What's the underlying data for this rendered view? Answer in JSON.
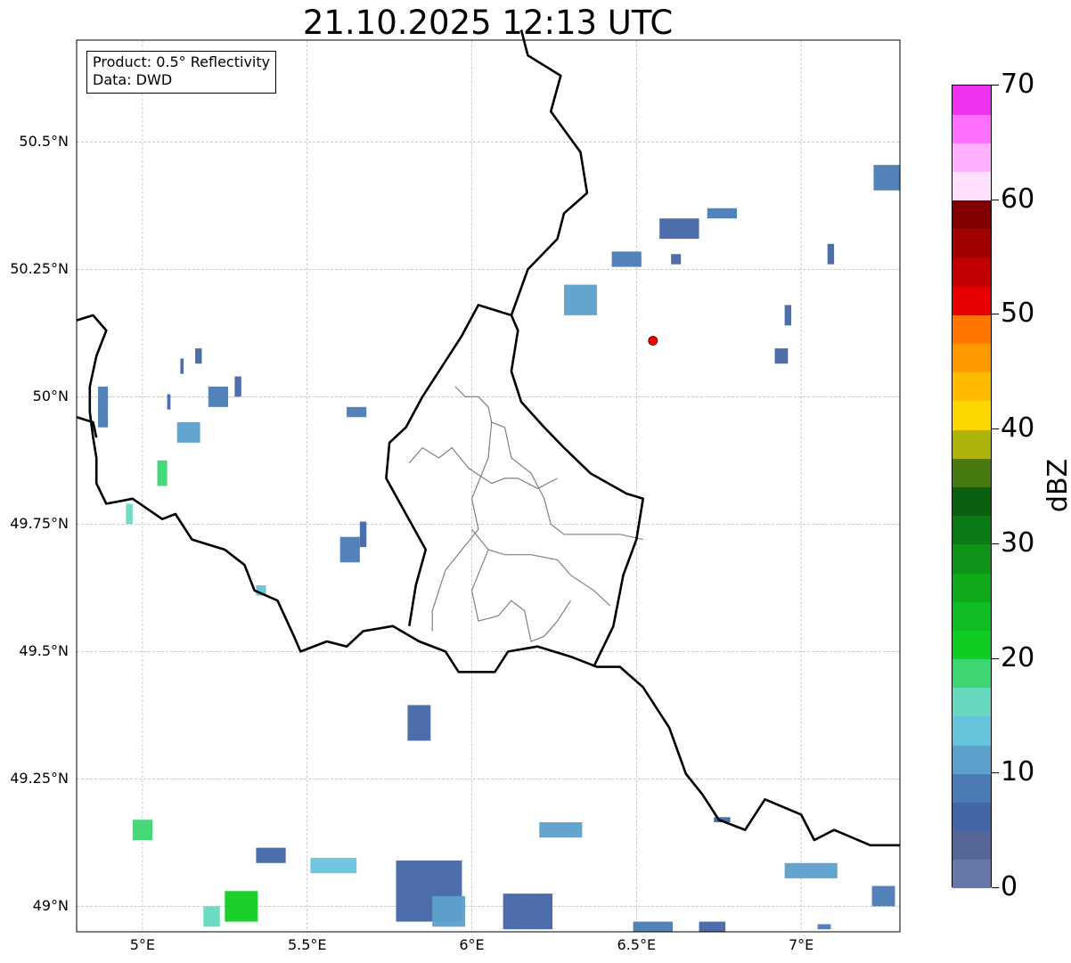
{
  "title": "21.10.2025 12:13 UTC",
  "info_box": {
    "product": "Product: 0.5° Reflectivity",
    "data": "Data: DWD"
  },
  "map_extent": {
    "lon_min": 4.8,
    "lon_max": 7.3,
    "lat_min": 48.95,
    "lat_max": 50.7
  },
  "lat_ticks": [
    {
      "value": 50.5,
      "label": "50.5°N"
    },
    {
      "value": 50.25,
      "label": "50.25°N"
    },
    {
      "value": 50.0,
      "label": "50°N"
    },
    {
      "value": 49.75,
      "label": "49.75°N"
    },
    {
      "value": 49.5,
      "label": "49.5°N"
    },
    {
      "value": 49.25,
      "label": "49.25°N"
    },
    {
      "value": 49.0,
      "label": "49°N"
    }
  ],
  "lon_ticks": [
    {
      "value": 5.0,
      "label": "5°E"
    },
    {
      "value": 5.5,
      "label": "5.5°E"
    },
    {
      "value": 6.0,
      "label": "6°E"
    },
    {
      "value": 6.5,
      "label": "6.5°E"
    },
    {
      "value": 7.0,
      "label": "7°E"
    }
  ],
  "radar_site": {
    "lon": 6.55,
    "lat": 50.11,
    "color": "#ff0000"
  },
  "colorbar": {
    "label": "dBZ",
    "min": 0,
    "max": 70,
    "step": 2.5,
    "tick_labels": [
      {
        "value": 0,
        "label": "0"
      },
      {
        "value": 10,
        "label": "10"
      },
      {
        "value": 20,
        "label": "20"
      },
      {
        "value": 30,
        "label": "30"
      },
      {
        "value": 40,
        "label": "40"
      },
      {
        "value": 50,
        "label": "50"
      },
      {
        "value": 60,
        "label": "60"
      },
      {
        "value": 70,
        "label": "70"
      }
    ],
    "colors": [
      "#6677aa",
      "#556699",
      "#4466a6",
      "#4a7bb5",
      "#5ca0cc",
      "#66c4dd",
      "#66d9bf",
      "#3dd672",
      "#11cc22",
      "#11bb22",
      "#11a81a",
      "#0f9218",
      "#0a7a14",
      "#0a5f10",
      "#477a10",
      "#adb30a",
      "#ffd700",
      "#ffbb00",
      "#ff9900",
      "#ff7700",
      "#e60000",
      "#c00000",
      "#a00000",
      "#800000",
      "#ffe0ff",
      "#ffb0ff",
      "#ff70ff",
      "#ee33ee"
    ]
  },
  "echoes": [
    {
      "lon": 4.88,
      "lat": 49.98,
      "w": 0.03,
      "h": 0.08,
      "c": "#4a7bb5"
    },
    {
      "lon": 5.08,
      "lat": 49.99,
      "w": 0.01,
      "h": 0.03,
      "c": "#4466a6"
    },
    {
      "lon": 5.12,
      "lat": 50.06,
      "w": 0.01,
      "h": 0.03,
      "c": "#4466a6"
    },
    {
      "lon": 5.17,
      "lat": 50.08,
      "w": 0.02,
      "h": 0.03,
      "c": "#4466a6"
    },
    {
      "lon": 5.23,
      "lat": 50.0,
      "w": 0.06,
      "h": 0.04,
      "c": "#4a7bb5"
    },
    {
      "lon": 5.29,
      "lat": 50.02,
      "w": 0.02,
      "h": 0.04,
      "c": "#4466a6"
    },
    {
      "lon": 5.14,
      "lat": 49.93,
      "w": 0.07,
      "h": 0.04,
      "c": "#5ca0cc"
    },
    {
      "lon": 5.06,
      "lat": 49.85,
      "w": 0.03,
      "h": 0.05,
      "c": "#3dd672"
    },
    {
      "lon": 4.96,
      "lat": 49.77,
      "w": 0.02,
      "h": 0.04,
      "c": "#66d9bf"
    },
    {
      "lon": 5.65,
      "lat": 49.97,
      "w": 0.06,
      "h": 0.02,
      "c": "#4a7bb5"
    },
    {
      "lon": 5.63,
      "lat": 49.7,
      "w": 0.06,
      "h": 0.05,
      "c": "#4a7bb5"
    },
    {
      "lon": 5.67,
      "lat": 49.73,
      "w": 0.02,
      "h": 0.05,
      "c": "#4466a6"
    },
    {
      "lon": 5.36,
      "lat": 49.62,
      "w": 0.03,
      "h": 0.02,
      "c": "#66c4dd"
    },
    {
      "lon": 5.84,
      "lat": 49.36,
      "w": 0.07,
      "h": 0.07,
      "c": "#4466a6"
    },
    {
      "lon": 6.33,
      "lat": 50.19,
      "w": 0.1,
      "h": 0.06,
      "c": "#5ca0cc"
    },
    {
      "lon": 6.47,
      "lat": 50.27,
      "w": 0.09,
      "h": 0.03,
      "c": "#4a7bb5"
    },
    {
      "lon": 6.63,
      "lat": 50.33,
      "w": 0.12,
      "h": 0.04,
      "c": "#4466a6"
    },
    {
      "lon": 6.76,
      "lat": 50.36,
      "w": 0.09,
      "h": 0.02,
      "c": "#4a7bb5"
    },
    {
      "lon": 6.62,
      "lat": 50.27,
      "w": 0.03,
      "h": 0.02,
      "c": "#4466a6"
    },
    {
      "lon": 6.94,
      "lat": 50.08,
      "w": 0.04,
      "h": 0.03,
      "c": "#4466a6"
    },
    {
      "lon": 6.96,
      "lat": 50.16,
      "w": 0.02,
      "h": 0.04,
      "c": "#4466a6"
    },
    {
      "lon": 7.09,
      "lat": 50.28,
      "w": 0.02,
      "h": 0.04,
      "c": "#4466a6"
    },
    {
      "lon": 7.26,
      "lat": 50.43,
      "w": 0.08,
      "h": 0.05,
      "c": "#4a7bb5"
    },
    {
      "lon": 6.27,
      "lat": 49.15,
      "w": 0.13,
      "h": 0.03,
      "c": "#5ca0cc"
    },
    {
      "lon": 6.76,
      "lat": 49.17,
      "w": 0.05,
      "h": 0.01,
      "c": "#4466a6"
    },
    {
      "lon": 7.03,
      "lat": 49.07,
      "w": 0.16,
      "h": 0.03,
      "c": "#5ca0cc"
    },
    {
      "lon": 7.25,
      "lat": 49.02,
      "w": 0.07,
      "h": 0.04,
      "c": "#4a7bb5"
    },
    {
      "lon": 5.0,
      "lat": 49.15,
      "w": 0.06,
      "h": 0.04,
      "c": "#3dd672"
    },
    {
      "lon": 5.39,
      "lat": 49.1,
      "w": 0.09,
      "h": 0.03,
      "c": "#4466a6"
    },
    {
      "lon": 5.3,
      "lat": 49.0,
      "w": 0.1,
      "h": 0.06,
      "c": "#11cc22"
    },
    {
      "lon": 5.21,
      "lat": 48.98,
      "w": 0.05,
      "h": 0.04,
      "c": "#66d9bf"
    },
    {
      "lon": 5.58,
      "lat": 49.08,
      "w": 0.14,
      "h": 0.03,
      "c": "#66c4dd"
    },
    {
      "lon": 5.87,
      "lat": 49.03,
      "w": 0.2,
      "h": 0.12,
      "c": "#4466a6"
    },
    {
      "lon": 5.93,
      "lat": 48.99,
      "w": 0.1,
      "h": 0.06,
      "c": "#5ca0cc"
    },
    {
      "lon": 6.17,
      "lat": 48.99,
      "w": 0.15,
      "h": 0.07,
      "c": "#4466a6"
    },
    {
      "lon": 6.55,
      "lat": 48.96,
      "w": 0.12,
      "h": 0.02,
      "c": "#4a7bb5"
    },
    {
      "lon": 6.73,
      "lat": 48.96,
      "w": 0.08,
      "h": 0.02,
      "c": "#4466a6"
    },
    {
      "lon": 7.07,
      "lat": 48.96,
      "w": 0.04,
      "h": 0.01,
      "c": "#4a7bb5"
    }
  ],
  "borders": [
    [
      [
        4.8,
        50.15
      ],
      [
        4.85,
        50.16
      ],
      [
        4.89,
        50.13
      ],
      [
        4.86,
        50.08
      ],
      [
        4.84,
        50.02
      ],
      [
        4.84,
        49.97
      ],
      [
        4.85,
        49.92
      ],
      [
        4.86,
        49.88
      ],
      [
        4.86,
        49.83
      ],
      [
        4.89,
        49.79
      ],
      [
        4.97,
        49.8
      ],
      [
        5.06,
        49.76
      ],
      [
        5.1,
        49.77
      ],
      [
        5.15,
        49.72
      ],
      [
        5.25,
        49.7
      ],
      [
        5.31,
        49.67
      ],
      [
        5.34,
        49.62
      ],
      [
        5.41,
        49.6
      ],
      [
        5.46,
        49.53
      ],
      [
        5.48,
        49.5
      ],
      [
        5.56,
        49.52
      ],
      [
        5.62,
        49.51
      ],
      [
        5.67,
        49.54
      ],
      [
        5.76,
        49.55
      ],
      [
        5.84,
        49.52
      ],
      [
        5.92,
        49.5
      ],
      [
        5.96,
        49.46
      ],
      [
        6.07,
        49.46
      ],
      [
        6.11,
        49.5
      ],
      [
        6.2,
        49.51
      ],
      [
        6.3,
        49.49
      ],
      [
        6.38,
        49.47
      ],
      [
        6.45,
        49.47
      ],
      [
        6.52,
        49.43
      ],
      [
        6.56,
        49.39
      ],
      [
        6.6,
        49.35
      ],
      [
        6.65,
        49.26
      ],
      [
        6.7,
        49.22
      ],
      [
        6.75,
        49.17
      ],
      [
        6.83,
        49.15
      ],
      [
        6.89,
        49.21
      ],
      [
        7.0,
        49.18
      ],
      [
        7.04,
        49.13
      ],
      [
        7.1,
        49.15
      ],
      [
        7.21,
        49.12
      ],
      [
        7.3,
        49.12
      ]
    ],
    [
      [
        4.8,
        49.96
      ],
      [
        4.85,
        49.95
      ],
      [
        4.86,
        49.92
      ]
    ],
    [
      [
        5.81,
        49.55
      ],
      [
        5.83,
        49.63
      ],
      [
        5.86,
        49.7
      ],
      [
        5.8,
        49.77
      ],
      [
        5.74,
        49.84
      ],
      [
        5.75,
        49.91
      ],
      [
        5.8,
        49.94
      ],
      [
        5.85,
        50.0
      ],
      [
        5.91,
        50.06
      ],
      [
        5.97,
        50.12
      ],
      [
        6.02,
        50.18
      ],
      [
        6.12,
        50.16
      ],
      [
        6.14,
        50.13
      ],
      [
        6.12,
        50.05
      ],
      [
        6.15,
        49.99
      ],
      [
        6.22,
        49.94
      ],
      [
        6.28,
        49.9
      ],
      [
        6.36,
        49.85
      ],
      [
        6.47,
        49.81
      ],
      [
        6.52,
        49.8
      ],
      [
        6.5,
        49.72
      ],
      [
        6.46,
        49.65
      ],
      [
        6.43,
        49.55
      ],
      [
        6.37,
        49.47
      ]
    ],
    [
      [
        6.12,
        50.16
      ],
      [
        6.17,
        50.25
      ],
      [
        6.26,
        50.31
      ],
      [
        6.28,
        50.36
      ],
      [
        6.35,
        50.4
      ],
      [
        6.33,
        50.48
      ],
      [
        6.24,
        50.56
      ],
      [
        6.27,
        50.63
      ],
      [
        6.17,
        50.67
      ],
      [
        6.15,
        50.72
      ]
    ]
  ],
  "districts": [
    [
      [
        5.95,
        50.02
      ],
      [
        5.98,
        50.0
      ],
      [
        6.02,
        50.0
      ],
      [
        6.05,
        49.98
      ],
      [
        6.06,
        49.95
      ],
      [
        6.1,
        49.94
      ]
    ],
    [
      [
        5.81,
        49.87
      ],
      [
        5.85,
        49.9
      ],
      [
        5.9,
        49.88
      ],
      [
        5.94,
        49.9
      ],
      [
        5.99,
        49.86
      ],
      [
        6.06,
        49.83
      ],
      [
        6.1,
        49.84
      ],
      [
        6.14,
        49.84
      ],
      [
        6.2,
        49.82
      ],
      [
        6.26,
        49.84
      ]
    ],
    [
      [
        6.06,
        49.95
      ],
      [
        6.05,
        49.88
      ],
      [
        6.0,
        49.8
      ],
      [
        6.02,
        49.74
      ],
      [
        5.97,
        49.7
      ],
      [
        5.92,
        49.66
      ]
    ],
    [
      [
        6.1,
        49.94
      ],
      [
        6.12,
        49.88
      ],
      [
        6.18,
        49.85
      ],
      [
        6.22,
        49.8
      ],
      [
        6.24,
        49.75
      ],
      [
        6.28,
        49.73
      ],
      [
        6.36,
        49.73
      ],
      [
        6.45,
        49.73
      ],
      [
        6.52,
        49.72
      ]
    ],
    [
      [
        6.0,
        49.74
      ],
      [
        6.05,
        49.7
      ],
      [
        6.1,
        49.69
      ],
      [
        6.18,
        49.69
      ],
      [
        6.26,
        49.68
      ],
      [
        6.3,
        49.65
      ],
      [
        6.37,
        49.62
      ],
      [
        6.42,
        49.59
      ]
    ],
    [
      [
        6.05,
        49.7
      ],
      [
        6.0,
        49.62
      ],
      [
        6.02,
        49.56
      ],
      [
        6.08,
        49.57
      ],
      [
        6.12,
        49.6
      ],
      [
        6.16,
        49.58
      ]
    ],
    [
      [
        5.92,
        49.66
      ],
      [
        5.88,
        49.58
      ],
      [
        5.88,
        49.54
      ]
    ],
    [
      [
        6.16,
        49.58
      ],
      [
        6.18,
        49.52
      ],
      [
        6.22,
        49.53
      ],
      [
        6.26,
        49.56
      ],
      [
        6.3,
        49.6
      ]
    ]
  ]
}
